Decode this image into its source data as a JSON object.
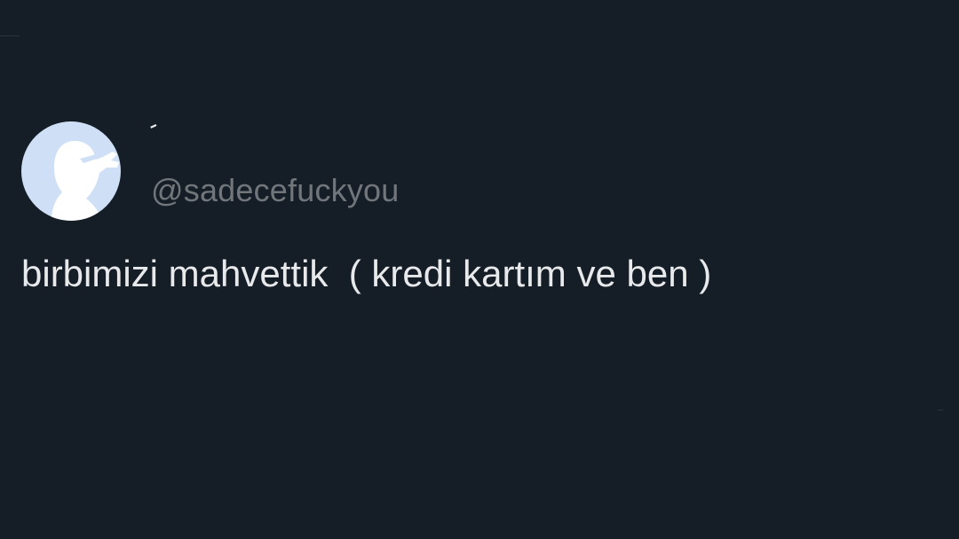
{
  "tweet": {
    "display_name": "-",
    "handle": "@sadecefuckyou",
    "text": "birbimizi mahvettik  ( kredi kartım ve ben )",
    "avatar_icon": "person-silhouette-finger-gun-icon"
  },
  "colors": {
    "background": "#151d27",
    "text_primary": "#e7e9ea",
    "text_secondary": "#71767b",
    "avatar_bg": "#cfe0f6",
    "avatar_figure": "#ffffff"
  }
}
